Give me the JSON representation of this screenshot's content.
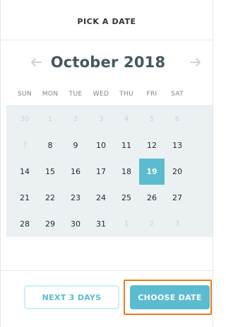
{
  "header": {
    "title": "PICK A DATE"
  },
  "calendar": {
    "month_label": "October 2018",
    "prev_icon": "arrow-left-icon",
    "next_icon": "arrow-right-icon",
    "weekdays": [
      "SUN",
      "MON",
      "TUE",
      "WED",
      "THU",
      "FRI",
      "SAT"
    ],
    "weeks": [
      [
        "30",
        "1",
        "2",
        "3",
        "4",
        "5",
        "6"
      ],
      [
        "7",
        "8",
        "9",
        "10",
        "11",
        "12",
        "13"
      ],
      [
        "14",
        "15",
        "16",
        "17",
        "18",
        "19",
        "20"
      ],
      [
        "21",
        "22",
        "23",
        "24",
        "25",
        "26",
        "27"
      ],
      [
        "28",
        "29",
        "30",
        "31",
        "1",
        "2",
        "3"
      ]
    ],
    "selected": "19"
  },
  "footer": {
    "secondary_button_label": "NEXT 3 DAYS",
    "primary_button_label": "CHOOSE DATE"
  },
  "colors": {
    "accent": "#5bbcd0",
    "muted_text": "#c7d2d7",
    "grid_background": "#ebf1f3",
    "focus_ring": "#e87c1b"
  }
}
